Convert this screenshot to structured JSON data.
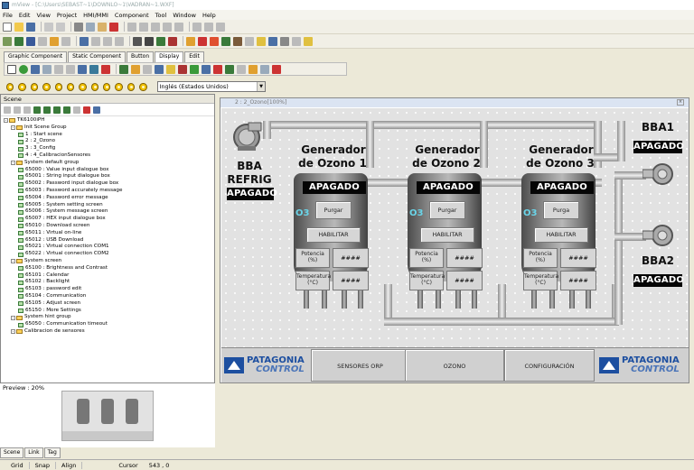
{
  "window": {
    "title": "mView - [C:\\Users\\SEBAST~1\\DOWNLO~1\\VADRAN~1.WXF]"
  },
  "menu": [
    "File",
    "Edit",
    "View",
    "Project",
    "HMI/MMI",
    "Component",
    "Tool",
    "Window",
    "Help"
  ],
  "palette_tabs": [
    "Graphic Component",
    "Static Component",
    "Button",
    "Display",
    "Edit"
  ],
  "language": {
    "selected": "Inglés (Estados Unidos)"
  },
  "scene": {
    "title": "Scene",
    "tree": [
      {
        "label": "TK6100iPH",
        "depth": 0,
        "kind": "root"
      },
      {
        "label": "Init Scene Group",
        "depth": 1,
        "kind": "folder"
      },
      {
        "label": "1 : Start scene",
        "depth": 2,
        "kind": "item"
      },
      {
        "label": "2 : 2_Ozono",
        "depth": 2,
        "kind": "item"
      },
      {
        "label": "3 : 3_Config",
        "depth": 2,
        "kind": "item"
      },
      {
        "label": "4 : 4_CalibracionSensores",
        "depth": 2,
        "kind": "item"
      },
      {
        "label": "System default group",
        "depth": 1,
        "kind": "folder"
      },
      {
        "label": "65000 : Value input dialogue box",
        "depth": 2,
        "kind": "item"
      },
      {
        "label": "65001 : String input dialogue box",
        "depth": 2,
        "kind": "item"
      },
      {
        "label": "65002 : Password input dialogue box",
        "depth": 2,
        "kind": "item"
      },
      {
        "label": "65003 : Password accurately message",
        "depth": 2,
        "kind": "item"
      },
      {
        "label": "65004 : Password error message",
        "depth": 2,
        "kind": "item"
      },
      {
        "label": "65005 : System setting screen",
        "depth": 2,
        "kind": "item"
      },
      {
        "label": "65006 : System message screen",
        "depth": 2,
        "kind": "item"
      },
      {
        "label": "65007 : HEX input dialogue box",
        "depth": 2,
        "kind": "item"
      },
      {
        "label": "65010 : Download screen",
        "depth": 2,
        "kind": "item"
      },
      {
        "label": "65011 : Virtual on-line",
        "depth": 2,
        "kind": "item"
      },
      {
        "label": "65012 : USB Download",
        "depth": 2,
        "kind": "item"
      },
      {
        "label": "65021 : Virtual connection COM1",
        "depth": 2,
        "kind": "item"
      },
      {
        "label": "65022 : Virtual connection COM2",
        "depth": 2,
        "kind": "item"
      },
      {
        "label": "System screen",
        "depth": 1,
        "kind": "folder"
      },
      {
        "label": "65100 : Brightness and Contrast",
        "depth": 2,
        "kind": "item"
      },
      {
        "label": "65101 : Calendar",
        "depth": 2,
        "kind": "item"
      },
      {
        "label": "65102 : Backlight",
        "depth": 2,
        "kind": "item"
      },
      {
        "label": "65103 : password edit",
        "depth": 2,
        "kind": "item"
      },
      {
        "label": "65104 : Communication",
        "depth": 2,
        "kind": "item"
      },
      {
        "label": "65105 : Adjust screen",
        "depth": 2,
        "kind": "item"
      },
      {
        "label": "65150 : More Settings",
        "depth": 2,
        "kind": "item"
      },
      {
        "label": "System hint group",
        "depth": 1,
        "kind": "folder"
      },
      {
        "label": "65050 : Communication timeout",
        "depth": 2,
        "kind": "item"
      },
      {
        "label": "Calibracion de sensores",
        "depth": 1,
        "kind": "folder"
      }
    ]
  },
  "preview": {
    "title": "Preview : 20%"
  },
  "bottom_tabs": [
    "Scene",
    "Link",
    "Tag"
  ],
  "status": {
    "grid": "Grid",
    "snap": "Snap",
    "align": "Align",
    "cursor_label": "Cursor",
    "cursor_value": "543 , 0"
  },
  "canvas": {
    "title": "2 : 2_Ozono[100%]",
    "bba_refrig": {
      "line1": "BBA",
      "line2": "REFRIG",
      "state": "APAGADO"
    },
    "bba1": {
      "name": "BBA1",
      "state": "APAGADO"
    },
    "bba2": {
      "name": "BBA2",
      "state": "APAGADO"
    },
    "generators": [
      {
        "title1": "Generador",
        "title2": "de Ozono 1",
        "state": "APAGADO",
        "o3": "O3",
        "purge": "Purgar",
        "enable": "HABILITAR",
        "power_label1": "Potencia",
        "power_label2": "(%)",
        "power_value": "####",
        "temp_label1": "Temperatura",
        "temp_label2": "(°C)",
        "temp_value": "####"
      },
      {
        "title1": "Generador",
        "title2": "de Ozono 2",
        "state": "APAGADO",
        "o3": "O3",
        "purge": "Purgar",
        "enable": "HABILITAR",
        "power_label1": "Potencia",
        "power_label2": "(%)",
        "power_value": "####",
        "temp_label1": "Temperatura",
        "temp_label2": "(°C)",
        "temp_value": "####"
      },
      {
        "title1": "Generador",
        "title2": "de Ozono 3",
        "state": "APAGADO",
        "o3": "O3",
        "purge": "Purga",
        "enable": "HABILITAR",
        "power_label1": "Potencia",
        "power_label2": "(%)",
        "power_value": "####",
        "temp_label1": "Temperatura",
        "temp_label2": "(°C)",
        "temp_value": "####"
      }
    ],
    "nav": {
      "sensors": "SENSORES ORP",
      "ozone": "OZONO",
      "config": "CONFIGURACIÓN"
    },
    "logo": {
      "line1": "PATAGONIA",
      "line2": "CONTROL"
    }
  }
}
